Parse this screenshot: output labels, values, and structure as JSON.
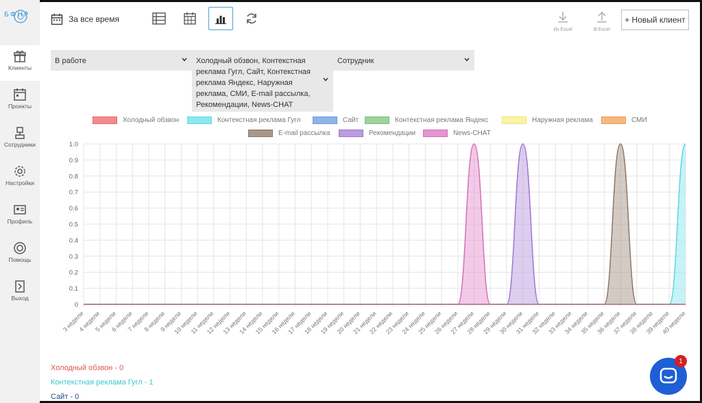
{
  "sidebar": {
    "logo_text": "БФНР",
    "items": [
      {
        "label": "Клиенты",
        "icon": "gift-icon",
        "active": true
      },
      {
        "label": "Проекты",
        "icon": "calendar-icon",
        "active": false
      },
      {
        "label": "Сотрудники",
        "icon": "employee-icon",
        "active": false
      },
      {
        "label": "Настройки",
        "icon": "gear-icon",
        "active": false
      },
      {
        "label": "Профиль",
        "icon": "profile-card-icon",
        "active": false
      },
      {
        "label": "Помощь",
        "icon": "lifebuoy-icon",
        "active": false
      },
      {
        "label": "Выход",
        "icon": "exit-door-icon",
        "active": false
      }
    ]
  },
  "toolbar": {
    "period_label": "За все время",
    "views": [
      {
        "name": "list-view",
        "icon": "list-icon",
        "active": false
      },
      {
        "name": "calendar-view",
        "icon": "calendar-grid-icon",
        "active": false
      },
      {
        "name": "chart-view",
        "icon": "bar-chart-icon",
        "active": true
      },
      {
        "name": "refresh",
        "icon": "refresh-icon",
        "active": false
      }
    ],
    "import_excel_label": "Из Excel",
    "export_excel_label": "В Excel",
    "new_client_label": "+ Новый клиент"
  },
  "filters": {
    "status_value": "В работе",
    "sources_value": "Холодный обзвон, Контекстная реклама Гугл, Сайт, Контекстная реклама Яндекс, Наружная реклама, СМИ, E-mail рассылка, Рекомендации, News-CHAT",
    "employee_value": "Сотрудник"
  },
  "legend": [
    {
      "label": "Холодный обзвон",
      "color": "#f28b8b",
      "border": "#e26a6a"
    },
    {
      "label": "Контекстная реклама Гугл",
      "color": "#8be8ef",
      "border": "#5fd6e0"
    },
    {
      "label": "Сайт",
      "color": "#8eb4e6",
      "border": "#6a98d8"
    },
    {
      "label": "Контекстная реклама Яндекс",
      "color": "#9ed39e",
      "border": "#78bf78"
    },
    {
      "label": "Наружная реклама",
      "color": "#fbf3a6",
      "border": "#efe17a"
    },
    {
      "label": "СМИ",
      "color": "#f5b980",
      "border": "#e99a55"
    },
    {
      "label": "E-mail рассылка",
      "color": "#a8968a",
      "border": "#8a7768"
    },
    {
      "label": "Рекомендации",
      "color": "#bb9ce0",
      "border": "#9c76d0"
    },
    {
      "label": "News-CHAT",
      "color": "#e596cf",
      "border": "#d56fba"
    }
  ],
  "chart_data": {
    "type": "area",
    "x": [
      "3 недели",
      "4 недели",
      "5 недели",
      "6 недели",
      "7 недели",
      "8 недели",
      "9 недели",
      "10 недели",
      "11 недели",
      "12 недели",
      "13 недели",
      "14 недели",
      "15 недели",
      "16 недели",
      "17 недели",
      "18 недели",
      "19 недели",
      "20 недели",
      "21 недели",
      "22 недели",
      "23 недели",
      "24 недели",
      "25 недели",
      "26 недели",
      "27 недели",
      "28 недели",
      "29 недели",
      "30 недели",
      "31 недели",
      "32 недели",
      "33 недели",
      "34 недели",
      "35 недели",
      "36 недели",
      "37 недели",
      "38 недели",
      "39 недели",
      "40 недели"
    ],
    "ylim": [
      0,
      1
    ],
    "y_ticks": [
      "0",
      "0.1",
      "0.2",
      "0.3",
      "0.4",
      "0.5",
      "0.6",
      "0.7",
      "0.8",
      "0.9",
      "1.0"
    ],
    "grid": true,
    "series": [
      {
        "name": "Холодный обзвон",
        "values": [
          0,
          0,
          0,
          0,
          0,
          0,
          0,
          0,
          0,
          0,
          0,
          0,
          0,
          0,
          0,
          0,
          0,
          0,
          0,
          0,
          0,
          0,
          0,
          0,
          0,
          0,
          0,
          0,
          0,
          0,
          0,
          0,
          0,
          0,
          0,
          0,
          0,
          0
        ]
      },
      {
        "name": "Контекстная реклама Гугл",
        "values": [
          0,
          0,
          0,
          0,
          0,
          0,
          0,
          0,
          0,
          0,
          0,
          0,
          0,
          0,
          0,
          0,
          0,
          0,
          0,
          0,
          0,
          0,
          0,
          0,
          0,
          0,
          0,
          0,
          0,
          0,
          0,
          0,
          0,
          0,
          0,
          0,
          0,
          1
        ]
      },
      {
        "name": "E-mail рассылка",
        "values": [
          0,
          0,
          0,
          0,
          0,
          0,
          0,
          0,
          0,
          0,
          0,
          0,
          0,
          0,
          0,
          0,
          0,
          0,
          0,
          0,
          0,
          0,
          0,
          0,
          0,
          0,
          0,
          0,
          0,
          0,
          0,
          0,
          0,
          1,
          0,
          0,
          0,
          0
        ]
      },
      {
        "name": "Рекомендации",
        "values": [
          0,
          0,
          0,
          0,
          0,
          0,
          0,
          0,
          0,
          0,
          0,
          0,
          0,
          0,
          0,
          0,
          0,
          0,
          0,
          0,
          0,
          0,
          0,
          0,
          0,
          0,
          0,
          1,
          0,
          0,
          0,
          0,
          0,
          0,
          0,
          0,
          0,
          0
        ]
      },
      {
        "name": "News-CHAT",
        "values": [
          0,
          0,
          0,
          0,
          0,
          0,
          0,
          0,
          0,
          0,
          0,
          0,
          0,
          0,
          0,
          0,
          0,
          0,
          0,
          0,
          0,
          0,
          0,
          0,
          1,
          0,
          0,
          0,
          0,
          0,
          0,
          0,
          0,
          0,
          0,
          0,
          0,
          0
        ]
      }
    ]
  },
  "stats": [
    {
      "text": "Холодный обзвон - 0",
      "color": "#e05555"
    },
    {
      "text": "Контекстная реклама Гугл - 1",
      "color": "#3cc6d2"
    },
    {
      "text": "Сайт - 0",
      "color": "#2c4a8a"
    }
  ],
  "chat": {
    "badge_count": "1",
    "icon": "chat-bubble-icon"
  }
}
